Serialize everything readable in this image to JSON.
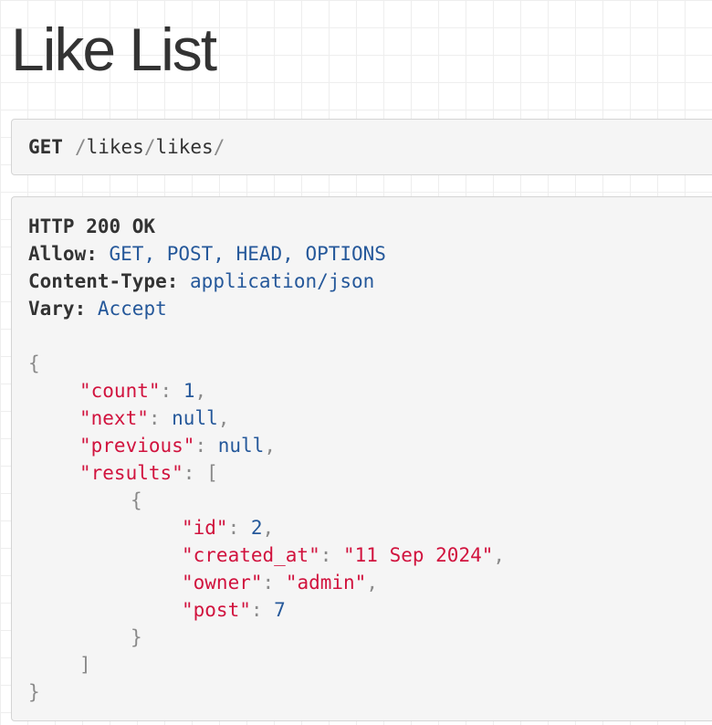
{
  "page": {
    "title": "Like List"
  },
  "request": {
    "method": "GET",
    "path_segments": [
      "likes",
      "likes"
    ],
    "slash": "/"
  },
  "response": {
    "status_line": "HTTP 200 OK",
    "headers": [
      {
        "name": "Allow:",
        "value": "GET, POST, HEAD, OPTIONS"
      },
      {
        "name": "Content-Type:",
        "value": "application/json"
      },
      {
        "name": "Vary:",
        "value": "Accept"
      }
    ],
    "body": {
      "open_brace": "{",
      "close_brace": "}",
      "open_bracket": "[",
      "close_bracket": "]",
      "colon": ": ",
      "comma": ",",
      "count_key": "\"count\"",
      "count_value": "1",
      "next_key": "\"next\"",
      "next_value": "null",
      "previous_key": "\"previous\"",
      "previous_value": "null",
      "results_key": "\"results\"",
      "results": [
        {
          "id_key": "\"id\"",
          "id_value": "2",
          "created_at_key": "\"created_at\"",
          "created_at_value": "\"11 Sep 2024\"",
          "owner_key": "\"owner\"",
          "owner_value": "\"admin\"",
          "post_key": "\"post\"",
          "post_value": "7"
        }
      ]
    }
  },
  "colors": {
    "string": "#d1133e",
    "literal": "#25589a",
    "punctuation": "#8a8a8a",
    "panel_background": "#f5f5f5",
    "text": "#333333"
  }
}
